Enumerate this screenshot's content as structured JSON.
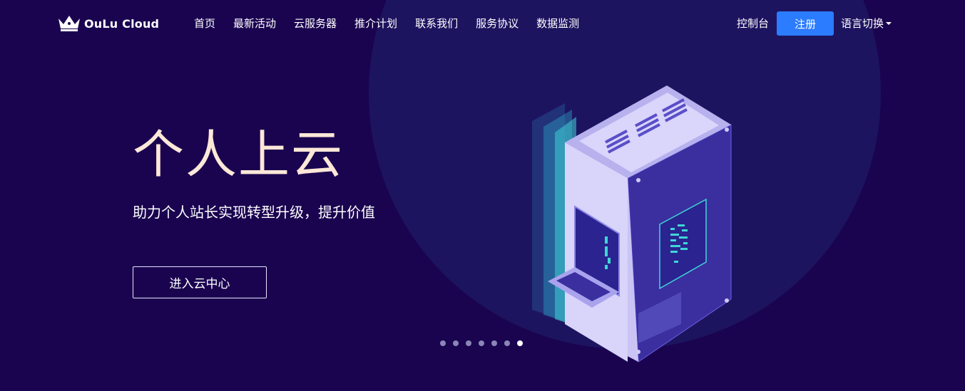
{
  "header": {
    "logo_text": "OuLu Cloud",
    "nav": [
      "首页",
      "最新活动",
      "云服务器",
      "推介计划",
      "联系我们",
      "服务协议",
      "数据监测"
    ],
    "console_label": "控制台",
    "register_label": "注册",
    "language_label": "语言切换"
  },
  "hero": {
    "title": "个人上云",
    "subtitle": "助力个人站长实现转型升级，提升价值",
    "cta_label": "进入云中心"
  },
  "carousel": {
    "slide_count": 7,
    "active_index": 6
  },
  "colors": {
    "background": "#1a0450",
    "circle": "#1d1460",
    "accent": "#2b7cff",
    "title": "#fde8d8"
  }
}
